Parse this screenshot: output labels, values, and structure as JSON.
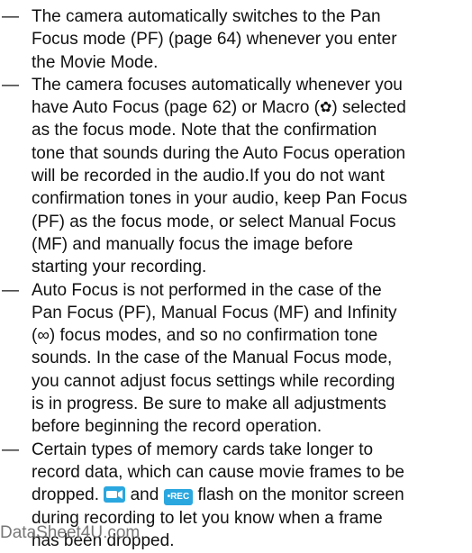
{
  "bullet_marker": "—",
  "notes": [
    {
      "lines": [
        "The camera automatically switches to the Pan",
        "Focus mode (PF) (page 64) whenever you enter",
        "the Movie Mode."
      ]
    },
    {
      "line1": "The camera focuses automatically whenever you",
      "line2_pre": "have Auto Focus (page 62) or Macro (",
      "macro_icon": "✿",
      "line2_post": ") selected",
      "lines_rest": [
        "as the focus mode. Note that the confirmation",
        "tone that sounds during the Auto Focus operation",
        "will be recorded in the audio.If you do not want",
        "confirmation tones in your audio, keep Pan Focus",
        "(PF) as the focus mode, or select Manual Focus",
        "(MF) and manually focus the image before",
        "starting your recording."
      ]
    },
    {
      "lines": [
        "Auto Focus is not performed in the case of the",
        "Pan Focus (PF), Manual Focus (MF) and Infinity",
        "(∞) focus modes, and so no confirmation tone",
        "sounds. In the case of the Manual Focus mode,",
        "you cannot adjust focus settings while recording",
        "is in progress. Be sure to make all adjustments",
        "before beginning the record operation."
      ]
    },
    {
      "line1": "Certain types of memory cards take longer to",
      "line2": "record data, which can cause movie frames to be",
      "line3_pre": "dropped. ",
      "line3_mid": " and ",
      "rec_icon_label": "•REC",
      "line3_post": " flash on the monitor screen",
      "line4": "during recording to let you know when a frame",
      "line5": "has been dropped."
    }
  ],
  "watermark": "DataSheet4U.com"
}
